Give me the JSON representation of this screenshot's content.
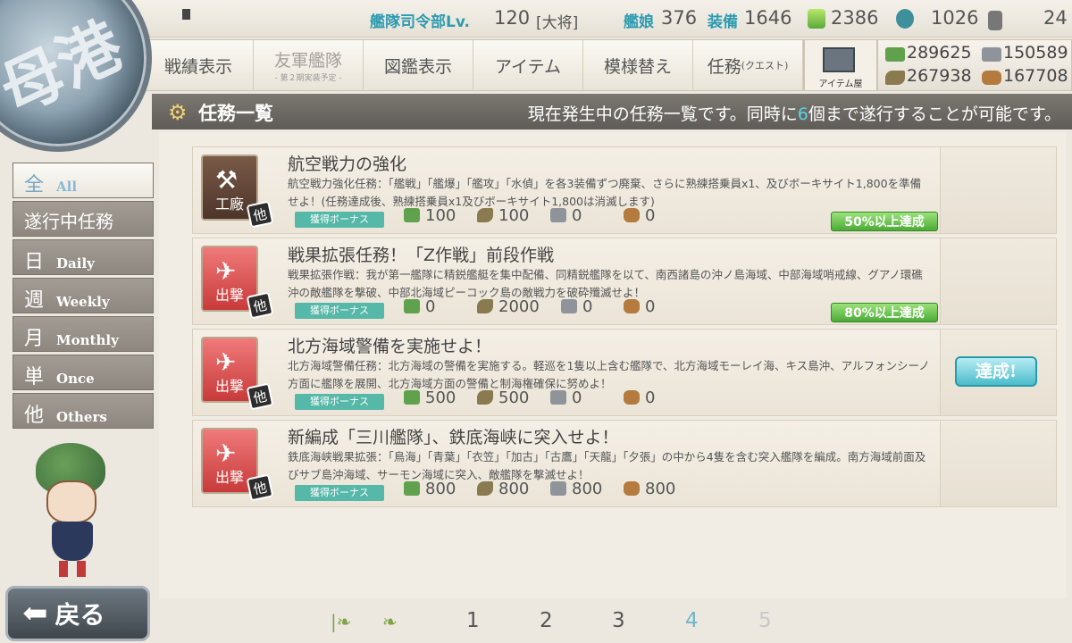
{
  "topbar": {
    "hq_label": "艦隊司令部Lv.",
    "hq_level": "120",
    "rank": "[大将]",
    "ships_label": "艦娘",
    "ships": "376",
    "equip_label": "装備",
    "equip": "1646",
    "bucket": "2386",
    "devmat": "1026",
    "screw": "24"
  },
  "menu": {
    "record": "戦績表示",
    "friend": "友軍艦隊",
    "friend_sub": "- 第２期実装予定 -",
    "library": "図鑑表示",
    "item": "アイテム",
    "furniture": "模様替え",
    "quest": "任務",
    "quest_small": "(クエスト)",
    "shop": "アイテム屋"
  },
  "resources": {
    "fuel": "289625",
    "steel": "150589",
    "ammo": "267938",
    "bauxite": "167708"
  },
  "header": {
    "title": "任務一覧",
    "info_pre": "現在発生中の任務一覧です。同時に",
    "info_num": "6",
    "info_post": "個まで遂行することが可能です。"
  },
  "tabs": [
    {
      "kanji": "全",
      "en": "All"
    },
    {
      "kanji": "遂行中任務",
      "en": ""
    },
    {
      "kanji": "日",
      "en": "Daily"
    },
    {
      "kanji": "週",
      "en": "Weekly"
    },
    {
      "kanji": "月",
      "en": "Monthly"
    },
    {
      "kanji": "単",
      "en": "Once"
    },
    {
      "kanji": "他",
      "en": "Others"
    }
  ],
  "quests": [
    {
      "category": "工廠",
      "title": "航空戦力の強化",
      "desc": "航空戦力強化任務：「艦戦」「艦爆」「艦攻」「水偵」を各3装備ずつ廃棄、さらに熟練搭乗員x1、及びボーキサイト1,800を準備せよ！(任務達成後、熟練搭乗員x1及びボーキサイト1,800は消滅します)",
      "bonus": "獲得ボーナス",
      "fuel": "100",
      "ammo": "100",
      "steel": "0",
      "bauxite": "0",
      "progress": "50%以上達成",
      "status": ""
    },
    {
      "category": "出撃",
      "title": "戦果拡張任務！「Z作戦」前段作戦",
      "desc": "戦果拡張作戦：我が第一艦隊に精鋭艦艇を集中配備、同精鋭艦隊を以て、南西諸島の沖ノ島海域、中部海域哨戒線、グアノ環礁沖の敵艦隊を撃破、中部北海域ピーコック島の敵戦力を破砕殲滅せよ！",
      "bonus": "獲得ボーナス",
      "fuel": "0",
      "ammo": "2000",
      "steel": "0",
      "bauxite": "0",
      "progress": "80%以上達成",
      "status": ""
    },
    {
      "category": "出撃",
      "title": "北方海域警備を実施せよ！",
      "desc": "北方海域警備任務：北方海域の警備を実施する。軽巡を1隻以上含む艦隊で、北方海域モーレイ海、キス島沖、アルフォンシーノ方面に艦隊を展開、北方海域方面の警備と制海権確保に努めよ！",
      "bonus": "獲得ボーナス",
      "fuel": "500",
      "ammo": "500",
      "steel": "0",
      "bauxite": "0",
      "progress": "",
      "status": "達成!"
    },
    {
      "category": "出撃",
      "title": "新編成「三川艦隊」、鉄底海峡に突入せよ！",
      "desc": "鉄底海峡戦果拡張：「鳥海」「青葉」「衣笠」「加古」「古鷹」「天龍」「夕張」の中から4隻を含む突入艦隊を編成。南方海域前面及びサブ島沖海域、サーモン海域に突入、敵艦隊を撃滅せよ！",
      "bonus": "獲得ボーナス",
      "fuel": "800",
      "ammo": "800",
      "steel": "800",
      "bauxite": "800",
      "progress": "",
      "status": ""
    }
  ],
  "other_badge": "他",
  "back_label": "戻る",
  "pager": {
    "pages": [
      "1",
      "2",
      "3",
      "4",
      "5"
    ],
    "current": "4"
  }
}
